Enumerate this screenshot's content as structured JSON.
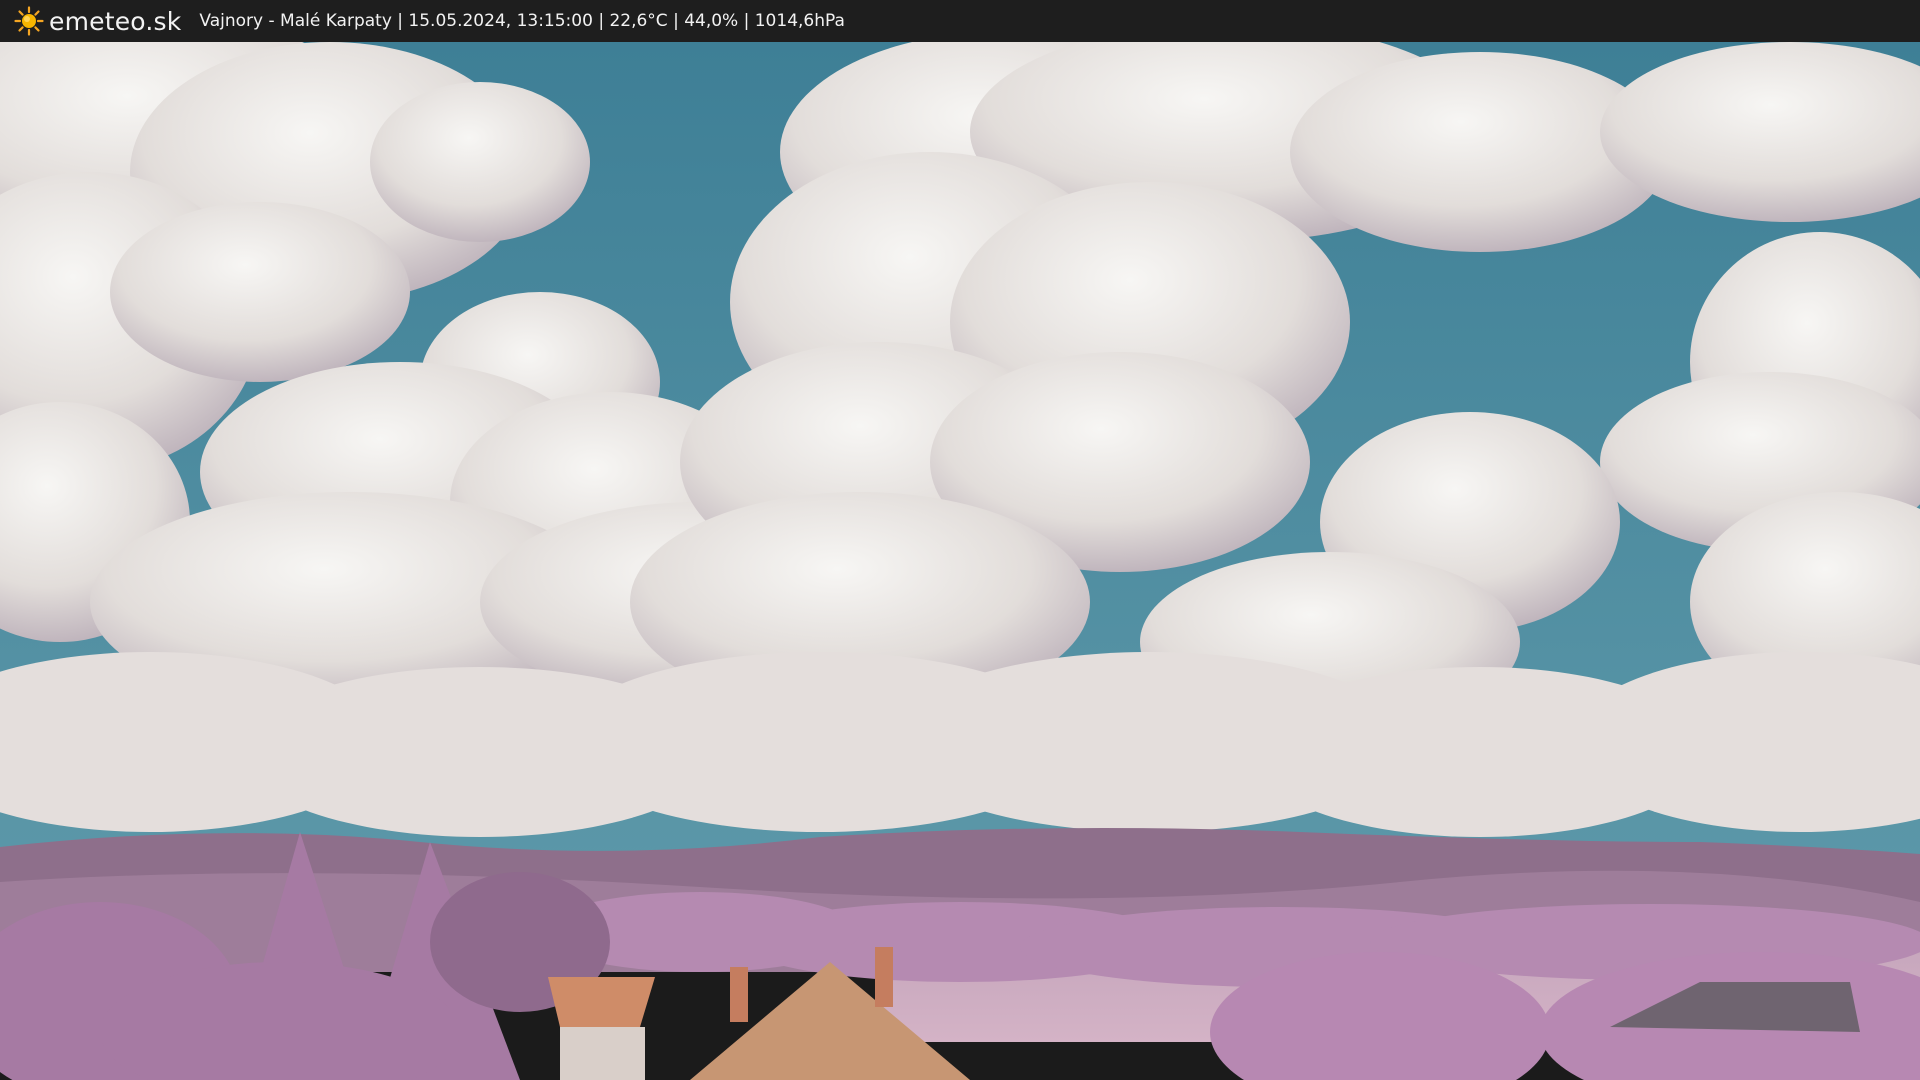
{
  "header": {
    "logo_icon": "sun-icon",
    "logo_text": "emeteo.sk",
    "station_info": "Vajnory - Malé Karpaty | 15.05.2024, 13:15:00 | 22,6°C | 44,0% | 1014,6hPa"
  },
  "colors": {
    "header_bg": "#1e1e1e",
    "sky": "#4e8fa4",
    "cloud": "#eceae8",
    "cloud_shadow": "#b3a8b4",
    "hills": "#8a6b86",
    "foliage": "#b78ab3",
    "roof": "#cf8c68"
  }
}
